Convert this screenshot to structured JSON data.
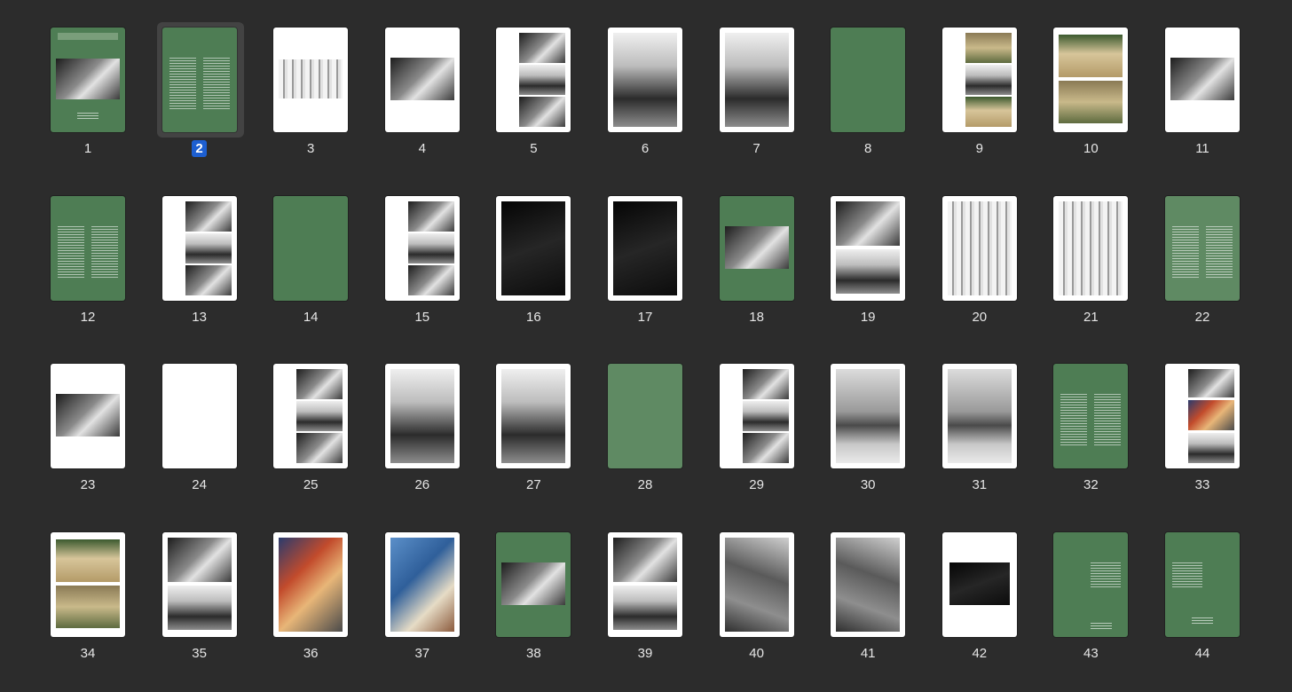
{
  "pages": [
    {
      "number": "1",
      "style": "cover"
    },
    {
      "number": "2",
      "style": "text2",
      "selected": true
    },
    {
      "number": "3",
      "style": "single-top"
    },
    {
      "number": "4",
      "style": "single-mid"
    },
    {
      "number": "5",
      "style": "triple-right"
    },
    {
      "number": "6",
      "style": "full-bw"
    },
    {
      "number": "7",
      "style": "full-bw"
    },
    {
      "number": "8",
      "style": "green-blank"
    },
    {
      "number": "9",
      "style": "triple-color"
    },
    {
      "number": "10",
      "style": "double-color"
    },
    {
      "number": "11",
      "style": "single-right"
    },
    {
      "number": "12",
      "style": "text2"
    },
    {
      "number": "13",
      "style": "triple-right"
    },
    {
      "number": "14",
      "style": "green-blank"
    },
    {
      "number": "15",
      "style": "triple-right"
    },
    {
      "number": "16",
      "style": "full-dark"
    },
    {
      "number": "17",
      "style": "full-dark"
    },
    {
      "number": "18",
      "style": "green-photo"
    },
    {
      "number": "19",
      "style": "double"
    },
    {
      "number": "20",
      "style": "full-stripes"
    },
    {
      "number": "21",
      "style": "full-stripes"
    },
    {
      "number": "22",
      "style": "text2-light"
    },
    {
      "number": "23",
      "style": "single-mid"
    },
    {
      "number": "24",
      "style": "blank"
    },
    {
      "number": "25",
      "style": "triple-right"
    },
    {
      "number": "26",
      "style": "full-bw"
    },
    {
      "number": "27",
      "style": "full-bw"
    },
    {
      "number": "28",
      "style": "green-blank-light"
    },
    {
      "number": "29",
      "style": "triple-right-stack"
    },
    {
      "number": "30",
      "style": "full-blur"
    },
    {
      "number": "31",
      "style": "full-blur"
    },
    {
      "number": "32",
      "style": "text2"
    },
    {
      "number": "33",
      "style": "triple-right-color"
    },
    {
      "number": "34",
      "style": "double-color"
    },
    {
      "number": "35",
      "style": "double"
    },
    {
      "number": "36",
      "style": "full-color1"
    },
    {
      "number": "37",
      "style": "full-color2"
    },
    {
      "number": "38",
      "style": "green-photo"
    },
    {
      "number": "39",
      "style": "double"
    },
    {
      "number": "40",
      "style": "full-track"
    },
    {
      "number": "41",
      "style": "full-track"
    },
    {
      "number": "42",
      "style": "single-mid-small"
    },
    {
      "number": "43",
      "style": "text-right"
    },
    {
      "number": "44",
      "style": "text-left"
    }
  ]
}
